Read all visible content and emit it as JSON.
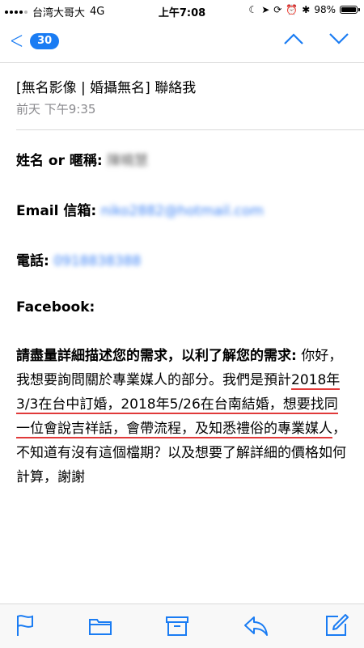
{
  "status_bar": {
    "carrier": "台湾大哥大",
    "network": "4G",
    "time": "上午7:08",
    "battery_percent": "98%",
    "battery_level": 0.98
  },
  "nav": {
    "unread_count": "30",
    "icons": [
      "chevron-left-icon",
      "chevron-up-icon",
      "chevron-down-icon"
    ]
  },
  "email": {
    "subject": "[無名影像 | 婚攝無名] 聯絡我",
    "date": "前天 下午9:35",
    "fields": [
      {
        "label": "姓名 or 暱稱:",
        "value": "陳曉慧"
      },
      {
        "label": "Email 信箱:",
        "value": "niko2882@hotmail.com"
      },
      {
        "label": "電話:",
        "value": "0918838388"
      },
      {
        "label": "Facebook:",
        "value": ""
      }
    ],
    "message_label": "請盡量詳細描述您的需求，以利了解您的需求:",
    "message_parts": [
      " 你好，我想要詢問關於專業媒人的部分。我們是預計",
      "2018年3/3在台中訂婚，2018年5/26在台南結婚，想要找同一位會說吉祥話，會帶流程，及知悉禮俗的專業媒人",
      "，不知道有沒有這個檔期？以及想要了解詳細的價格如何計算，謝謝"
    ]
  },
  "toolbar": {
    "icons": [
      "flag-icon",
      "folder-icon",
      "archive-icon",
      "reply-icon",
      "compose-icon"
    ]
  },
  "colors": {
    "accent": "#1a7cf3",
    "highlight_underline": "#e03a3a",
    "secondary_text": "#8a8a8e"
  }
}
